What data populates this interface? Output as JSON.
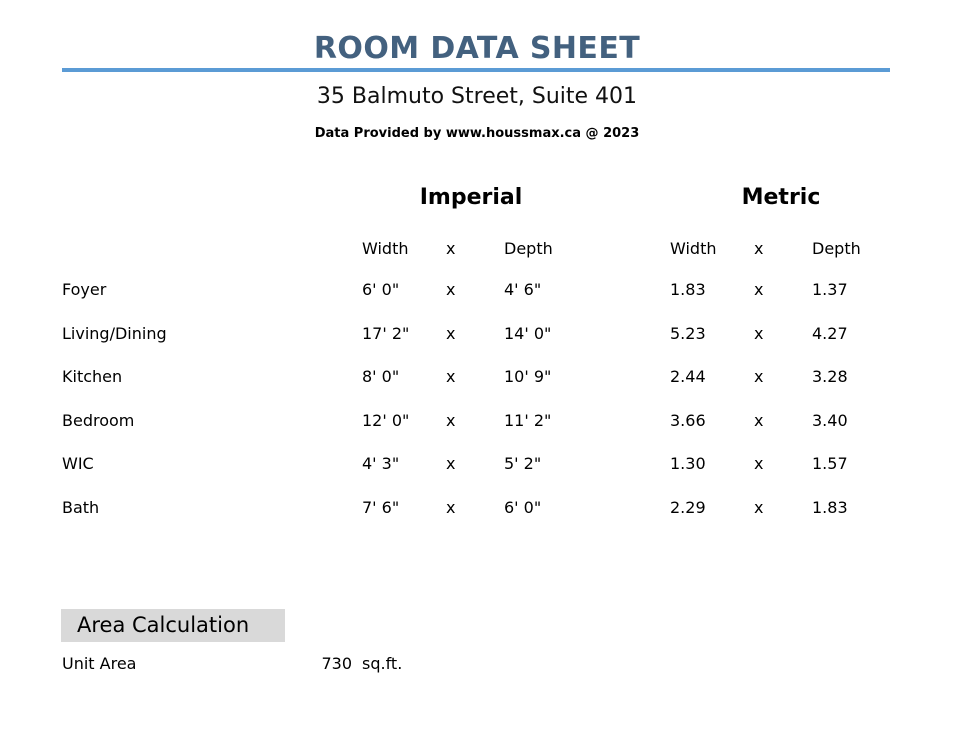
{
  "header": {
    "title": "ROOM DATA SHEET",
    "address": "35 Balmuto Street, Suite 401",
    "credit": "Data Provided by www.houssmax.ca @ 2023",
    "rule_color": "#5B9BD5",
    "title_color": "#43617F"
  },
  "table": {
    "unit_groups": [
      {
        "label": "Imperial"
      },
      {
        "label": "Metric"
      }
    ],
    "columns": {
      "room": "",
      "imperial_width": "Width",
      "imperial_x": "x",
      "imperial_depth": "Depth",
      "metric_width": "Width",
      "metric_x": "x",
      "metric_depth": "Depth"
    },
    "rows": [
      {
        "room": "Foyer",
        "imperial_width": "6' 0\"",
        "imperial_x": "x",
        "imperial_depth": "4' 6\"",
        "metric_width": "1.83",
        "metric_x": "x",
        "metric_depth": "1.37"
      },
      {
        "room": "Living/Dining",
        "imperial_width": "17' 2\"",
        "imperial_x": "x",
        "imperial_depth": "14' 0\"",
        "metric_width": "5.23",
        "metric_x": "x",
        "metric_depth": "4.27"
      },
      {
        "room": "Kitchen",
        "imperial_width": "8' 0\"",
        "imperial_x": "x",
        "imperial_depth": "10' 9\"",
        "metric_width": "2.44",
        "metric_x": "x",
        "metric_depth": "3.28"
      },
      {
        "room": "Bedroom",
        "imperial_width": "12' 0\"",
        "imperial_x": "x",
        "imperial_depth": "11' 2\"",
        "metric_width": "3.66",
        "metric_x": "x",
        "metric_depth": "3.40"
      },
      {
        "room": "WIC",
        "imperial_width": "4' 3\"",
        "imperial_x": "x",
        "imperial_depth": "5' 2\"",
        "metric_width": "1.30",
        "metric_x": "x",
        "metric_depth": "1.57"
      },
      {
        "room": "Bath",
        "imperial_width": "7' 6\"",
        "imperial_x": "x",
        "imperial_depth": "6' 0\"",
        "metric_width": "2.29",
        "metric_x": "x",
        "metric_depth": "1.83"
      }
    ]
  },
  "area_calculation": {
    "section_title": "Area Calculation",
    "banner_color": "#D9D9D9",
    "unit_area_label": "Unit Area",
    "unit_area_value": "730",
    "unit_area_unit": "sq.ft."
  }
}
